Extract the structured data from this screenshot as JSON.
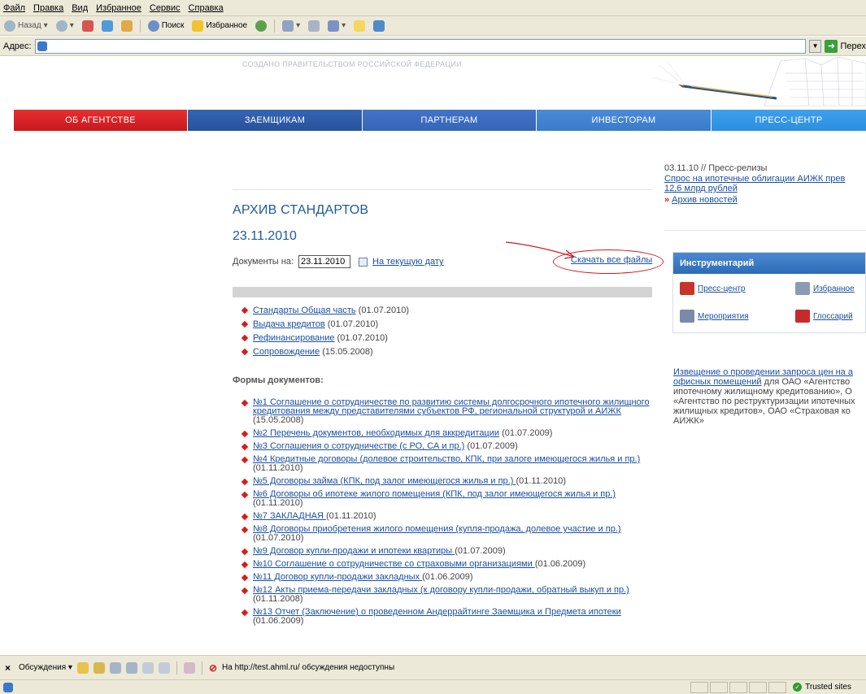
{
  "browser": {
    "menu": [
      "Файл",
      "Правка",
      "Вид",
      "Избранное",
      "Сервис",
      "Справка"
    ],
    "toolbar": {
      "back_label": "Назад",
      "search_label": "Поиск",
      "favorites_label": "Избранное"
    },
    "address": {
      "label": "Адрес:",
      "value": "",
      "go_label": "Перех"
    }
  },
  "header": {
    "tagline": "СОЗДАНО ПРАВИТЕЛЬСТВОМ РОССИЙСКОЙ ФЕДЕРАЦИИ"
  },
  "nav": {
    "tabs": [
      {
        "label": "ОБ АГЕНТСТВЕ",
        "color": "#d11f24"
      },
      {
        "label": "ЗАЕМЩИКАМ",
        "color": "#2d5aa8"
      },
      {
        "label": "ПАРТНЕРАМ",
        "color": "#3a6cc0"
      },
      {
        "label": "ИНВЕСТОРАМ",
        "color": "#3f82cf"
      },
      {
        "label": "ПРЕСС-ЦЕНТР",
        "color": "#2f96e3"
      }
    ]
  },
  "main": {
    "title": "АРХИВ СТАНДАРТОВ",
    "date": "23.11.2010",
    "docs_label": "Документы на:",
    "docs_input_value": "23.11.2010",
    "current_date_link": "На текущую дату",
    "download_all_link": "Скачать все файлы",
    "standards": [
      {
        "link": "Стандарты Общая часть",
        "date": " (01.07.2010)"
      },
      {
        "link": "Выдача кредитов",
        "date": " (01.07.2010)"
      },
      {
        "link": "Рефинансирование",
        "date": " (01.07.2010)"
      },
      {
        "link": "Сопровождение",
        "date": " (15.05.2008)"
      }
    ],
    "forms_heading": "Формы документов:",
    "forms": [
      {
        "link": "№1 Соглашение о сотрудничестве по развитию системы долгосрочного ипотечного жилищного кредитования между представителями субъектов РФ, региональной структурой и АИЖК ",
        "date": "(15.05.2008)"
      },
      {
        "link": "№2 Перечень документов, необходимых для аккредитации",
        "date": " (01.07.2009)"
      },
      {
        "link": "№3 Соглашения о сотрудничестве (с РО, СА и пр.)",
        "date": " (01.07.2009)"
      },
      {
        "link": "№4 Кредитные договоры (долевое строительство, КПК, при залоге имеющегося жилья и пр.)",
        "date": " (01.11.2010)"
      },
      {
        "link": "№5 Договоры займа (КПК, под залог имеющегося жилья и пр.) ",
        "date": "(01.11.2010)"
      },
      {
        "link": "№6 Договоры об ипотеке жилого помещения (КПК, под залог имеющегося жилья и пр.)",
        "date": " (01.11.2010)"
      },
      {
        "link": "№7 ЗАКЛАДНАЯ ",
        "date": "(01.11.2010)"
      },
      {
        "link": "№8 Договоры приобретения жилого помещения (купля-продажа, долевое участие и пр.)",
        "date": " (01.07.2010)"
      },
      {
        "link": "№9 Договор купли-продажи и ипотеки квартиры ",
        "date": "(01.07.2009)"
      },
      {
        "link": "№10 Соглашение о сотрудничестве со страховыми организациями ",
        "date": "(01.06.2009)"
      },
      {
        "link": "№11 Договор купли-продажи закладных ",
        "date": "(01.06.2009)"
      },
      {
        "link": "№12 Акты приема-передачи закладных (к договору купли-продажи, обратный выкуп и пр.)",
        "date": " (01.11.2008)"
      },
      {
        "link": "№13 Отчет (Заключение) о проведенном Андеррайтинге Заемщика и Предмета ипотеки",
        "date": " (01.06.2009)"
      }
    ]
  },
  "sidebar": {
    "news_date": "03.11.10 // Пресс-релизы",
    "news_link_line1": "Спрос на ипотечные облигации АИЖК прев",
    "news_link_line2": "12,6 млрд рублей",
    "news_archive": "Архив новостей",
    "tools_title": "Инструментарий",
    "tools": [
      {
        "label": "Пресс-центр",
        "icon": "press-center-icon",
        "color": "#c8342a"
      },
      {
        "label": "Избранное",
        "icon": "favorites-icon",
        "color": "#8a9bb5"
      },
      {
        "label": "Мероприятия",
        "icon": "events-icon",
        "color": "#7a8aa8"
      },
      {
        "label": "Глоссарий",
        "icon": "glossary-icon",
        "color": "#c62b2b"
      }
    ],
    "tender_link_line1": "Извещение о проведении запроса цен на а",
    "tender_link_line2": "офисных помещений",
    "tender_text": [
      " для ОАО «Агентство",
      "ипотечному жилищному кредитованию», О",
      "«Агентство по реструктуризации ипотечных",
      "жилищных кредитов», ОАО «Страховая ко",
      "АИЖК»"
    ]
  },
  "discuss_bar": {
    "label": "Обсуждения",
    "message": "На http://test.ahml.ru/ обсуждения недоступны"
  },
  "statusbar": {
    "zone": "Trusted sites"
  }
}
